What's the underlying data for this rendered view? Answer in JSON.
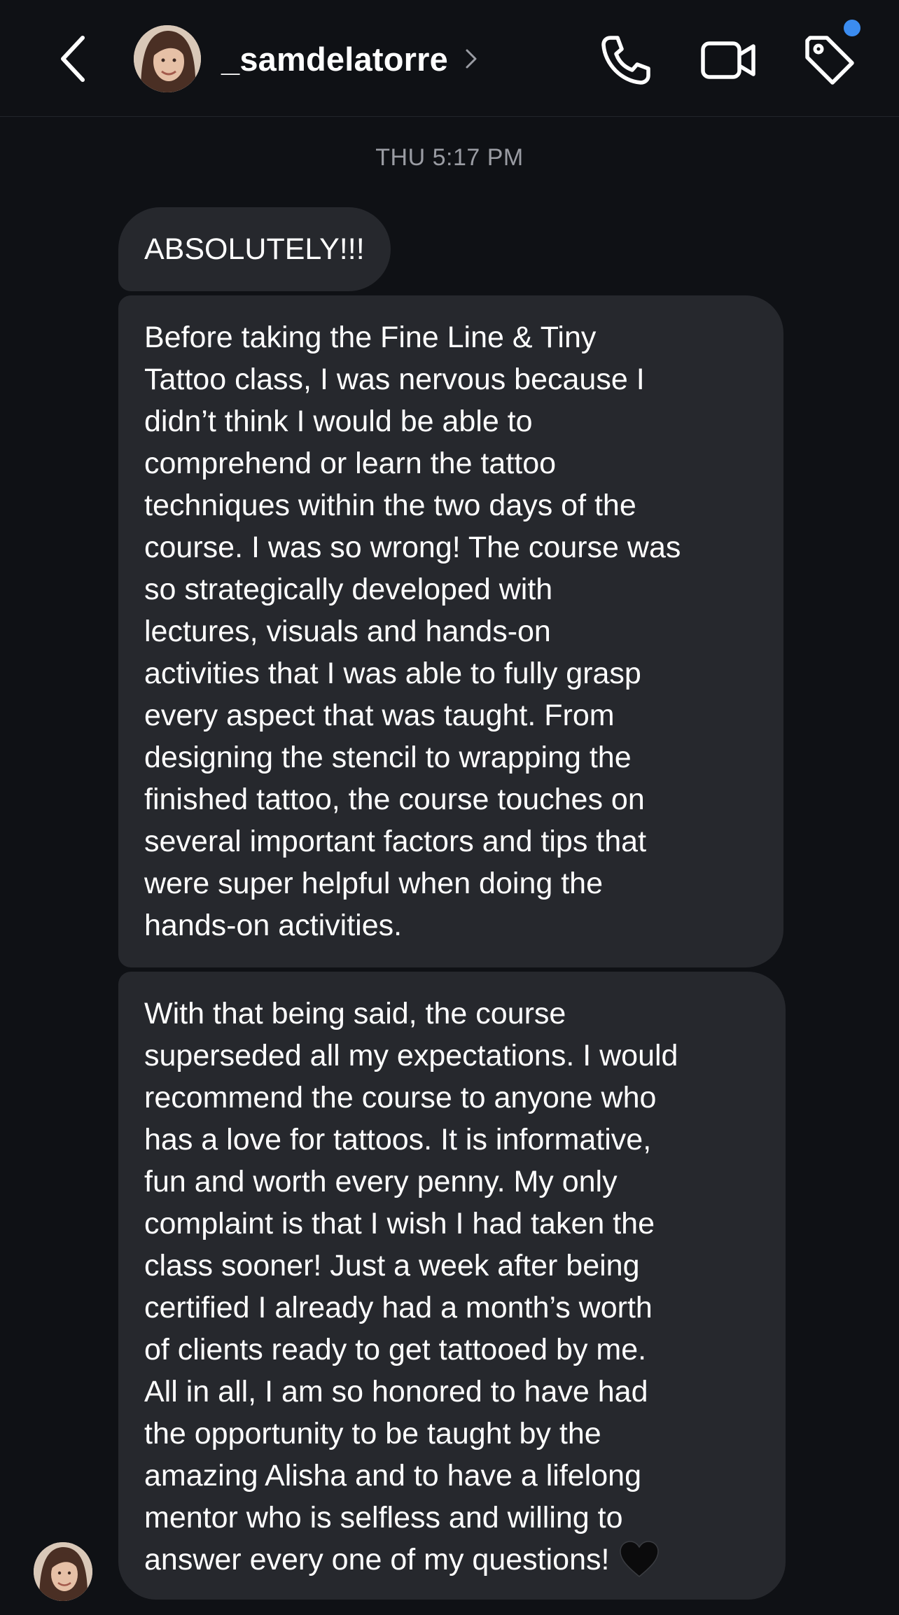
{
  "header": {
    "username": "_samdelatorre",
    "has_notification": true
  },
  "thread": {
    "timestamp": "THU 5:17 PM",
    "messages": [
      {
        "text": "ABSOLUTELY!!!"
      },
      {
        "text": "Before taking the Fine Line & Tiny\nTattoo class, I was nervous because I\ndidn’t think I would be able to\ncomprehend or learn the tattoo\ntechniques within the two days of the\ncourse. I was so wrong! The course was\nso strategically developed with\nlectures, visuals and hands-on\nactivities that I was able to fully grasp\nevery aspect that was taught. From\ndesigning the stencil to wrapping the\nfinished tattoo, the course touches on\nseveral important factors and tips that\nwere super helpful when doing the\nhands-on activities."
      },
      {
        "text": "With that being said, the course\nsuperseded all my expectations. I would\nrecommend the course to anyone who\nhas a love for tattoos. It is informative,\nfun and worth every penny. My only\ncomplaint is that I wish I had taken the\nclass sooner!  Just a week after being\ncertified I already had a month’s worth\nof clients ready to get tattooed by me.\nAll in all, I am so honored to have had\nthe opportunity to be taught by the\namazing Alisha and to have a lifelong\nmentor who is selfless and willing to\nanswer every one of my questions!"
      }
    ]
  },
  "icons": {
    "back": "chevron-left-icon",
    "phone": "phone-icon",
    "video": "video-camera-icon",
    "tag": "tag-icon",
    "heart": "black-heart-emoji"
  },
  "colors": {
    "background": "#0f1115",
    "bubble": "#26282d",
    "timestamp": "#9a9ca3",
    "notification": "#3b8cf0"
  }
}
